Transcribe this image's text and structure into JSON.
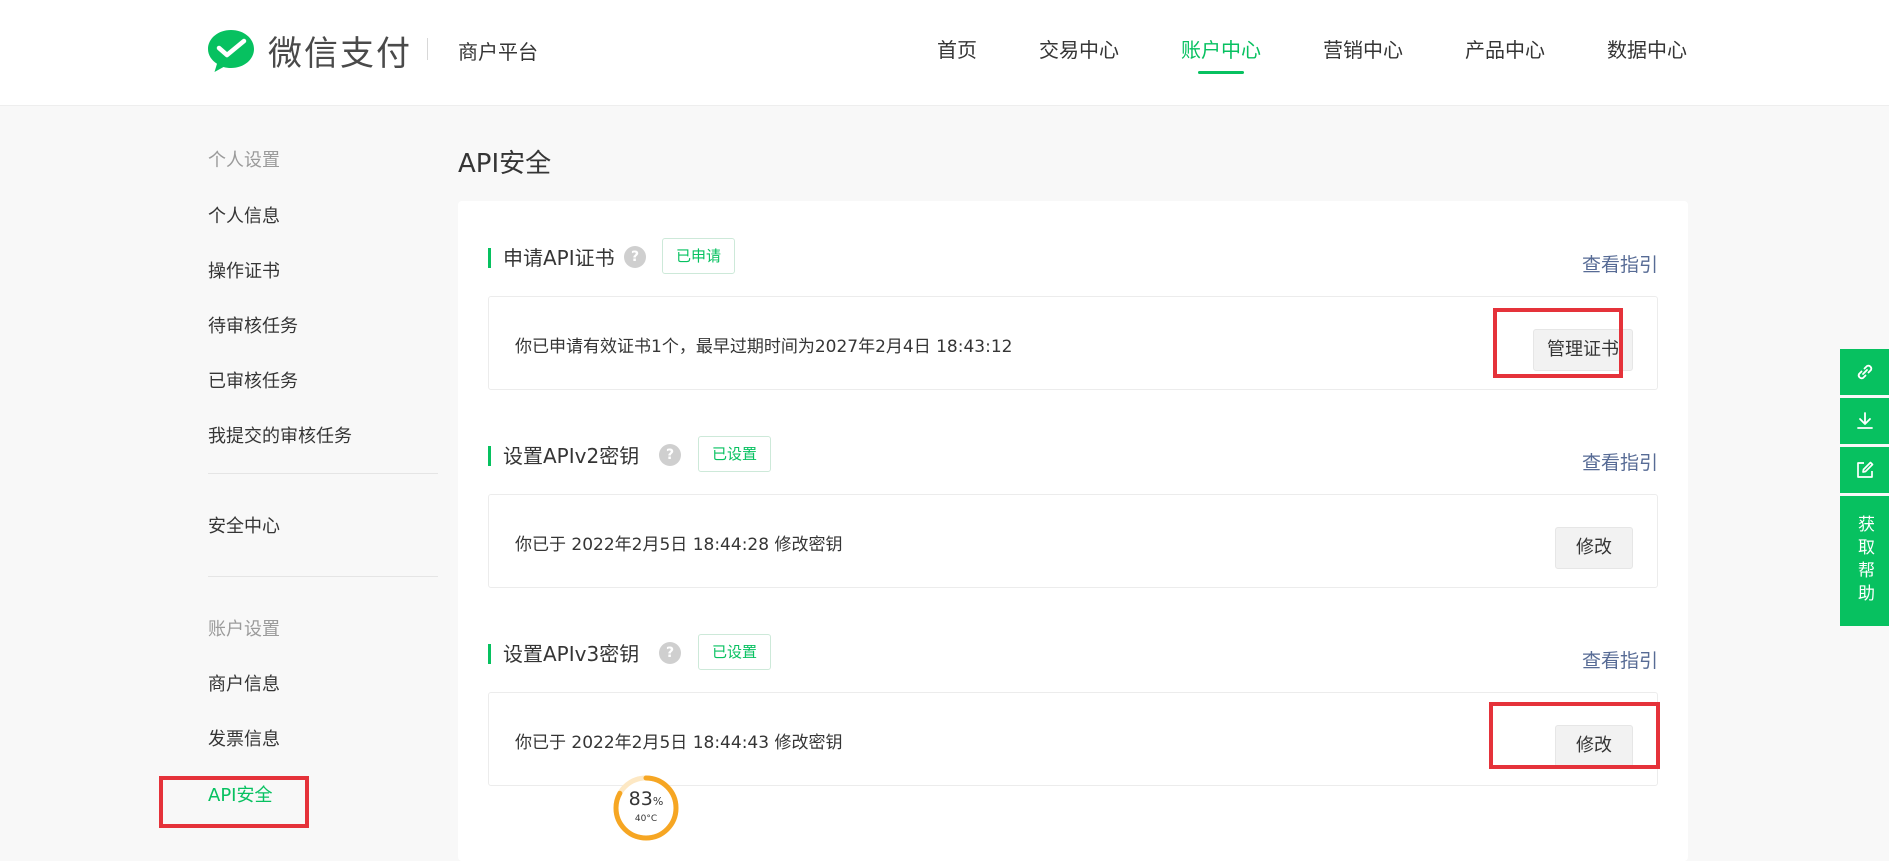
{
  "header": {
    "logo_text": "微信支付",
    "platform": "商户平台",
    "nav": [
      {
        "label": "首页",
        "active": false
      },
      {
        "label": "交易中心",
        "active": false
      },
      {
        "label": "账户中心",
        "active": true
      },
      {
        "label": "营销中心",
        "active": false
      },
      {
        "label": "产品中心",
        "active": false
      },
      {
        "label": "数据中心",
        "active": false
      }
    ]
  },
  "sidebar": {
    "personal_title": "个人设置",
    "personal_items": [
      "个人信息",
      "操作证书",
      "待审核任务",
      "已审核任务",
      "我提交的审核任务"
    ],
    "security_item": "安全中心",
    "account_title": "账户设置",
    "account_items": [
      "商户信息",
      "发票信息",
      "API安全"
    ],
    "active_item": "API安全"
  },
  "main": {
    "title": "API安全",
    "sections": [
      {
        "title": "申请API证书",
        "status": "已申请",
        "guide": "查看指引",
        "text": "你已申请有效证书1个，最早过期时间为2027年2月4日 18:43:12",
        "button": "管理证书"
      },
      {
        "title": "设置APIv2密钥",
        "status": "已设置",
        "guide": "查看指引",
        "text": "你已于 2022年2月5日 18:44:28 修改密钥",
        "button": "修改"
      },
      {
        "title": "设置APIv3密钥",
        "status": "已设置",
        "guide": "查看指引",
        "text": "你已于 2022年2月5日 18:44:43 修改密钥",
        "button": "修改"
      }
    ]
  },
  "float_bar": {
    "icons": [
      "link-icon",
      "download-icon",
      "edit-icon"
    ],
    "help": "获取帮助"
  },
  "widget": {
    "percent": 83,
    "percent_unit": "%",
    "temperature": "40°C"
  },
  "colors": {
    "accent": "#07c160",
    "link": "#576b95",
    "highlight": "#e5323a"
  }
}
